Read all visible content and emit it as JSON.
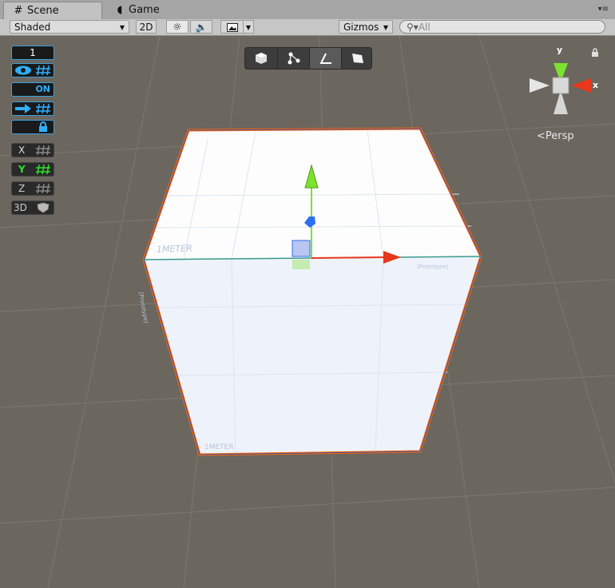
{
  "tabs": {
    "scene": {
      "label": "Scene",
      "icon": "hash-icon"
    },
    "game": {
      "label": "Game",
      "icon": "pacman-icon"
    }
  },
  "toolbar": {
    "shading_mode": "Shaded",
    "two_d_label": "2D",
    "gizmos_label": "Gizmos",
    "search_placeholder": "All"
  },
  "side_panel": {
    "layer_count": "1",
    "on_label": "ON",
    "x_label": "X",
    "y_label": "Y",
    "z_label": "Z",
    "three_d_label": "3D"
  },
  "scene": {
    "projection_label": "Persp",
    "axis_labels": {
      "y": "y",
      "x": "x"
    },
    "cube_texture_labels": {
      "top_left": "1METER",
      "bottom_left": "1METER",
      "prototype": "[Prototype]",
      "left_prototype": "[Prototype]"
    },
    "colors": {
      "selection_outline": "#ff6a00",
      "x_axis": "#e8381c",
      "y_axis": "#7ce22e",
      "z_axis": "#2d6ef0"
    }
  }
}
